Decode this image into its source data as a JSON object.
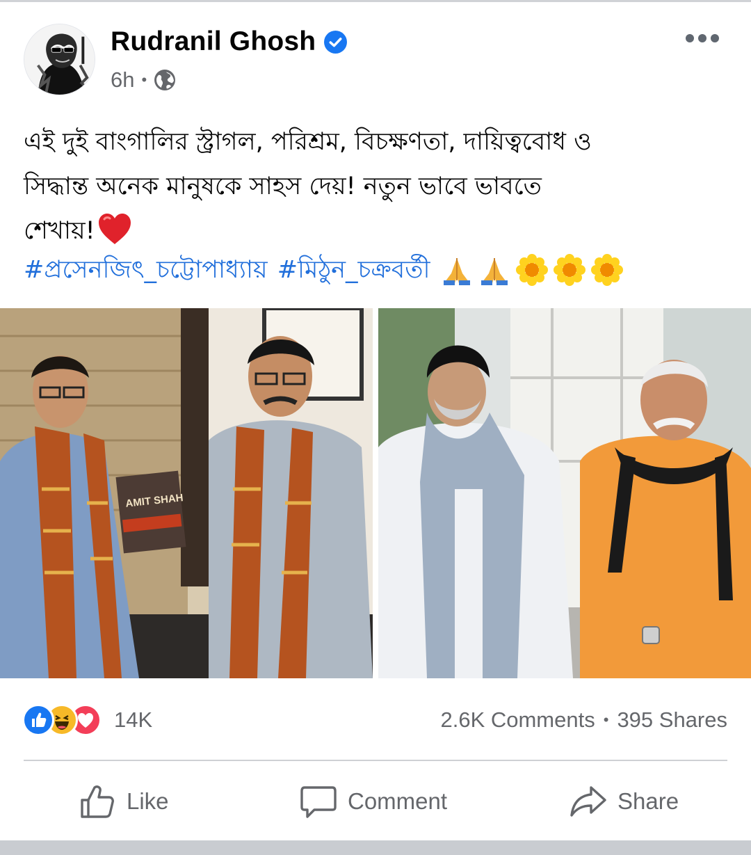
{
  "post": {
    "author": "Rudranil Ghosh",
    "verified_icon": "verified-badge-icon",
    "time": "6h",
    "separator": "•",
    "audience_icon": "globe-icon",
    "more_icon": "more-options-icon",
    "text_line1": "এই দুই বাংগালির স্ট্রাগল, পরিশ্রম, বিচক্ষণতা, দায়িত্ববোধ ও",
    "text_line2": "সিদ্ধান্ত অনেক মানুষকে সাহস দেয়!  নতুন ভাবে ভাবতে",
    "text_line3": "শেখায়!",
    "hashtags": [
      "#প্রসেনজিৎ_চট্টোপাধ্যায়",
      "#মিঠুন_চক্রবর্তী"
    ],
    "trailing_emoji": [
      "folded-hands",
      "folded-hands",
      "blossom",
      "blossom",
      "blossom"
    ],
    "photo_left_book_title": "AMIT SHAH"
  },
  "engagement": {
    "reaction_icons": [
      "like",
      "haha",
      "love"
    ],
    "reaction_count": "14K",
    "comments": "2.6K Comments",
    "separator": "•",
    "shares": "395 Shares"
  },
  "actions": {
    "like": "Like",
    "comment": "Comment",
    "share": "Share"
  },
  "colors": {
    "link": "#216fdb",
    "secondary_text": "#65676b",
    "verified": "#1877f2",
    "like": "#1877f2",
    "love": "#f33e58",
    "haha": "#f7b928"
  }
}
